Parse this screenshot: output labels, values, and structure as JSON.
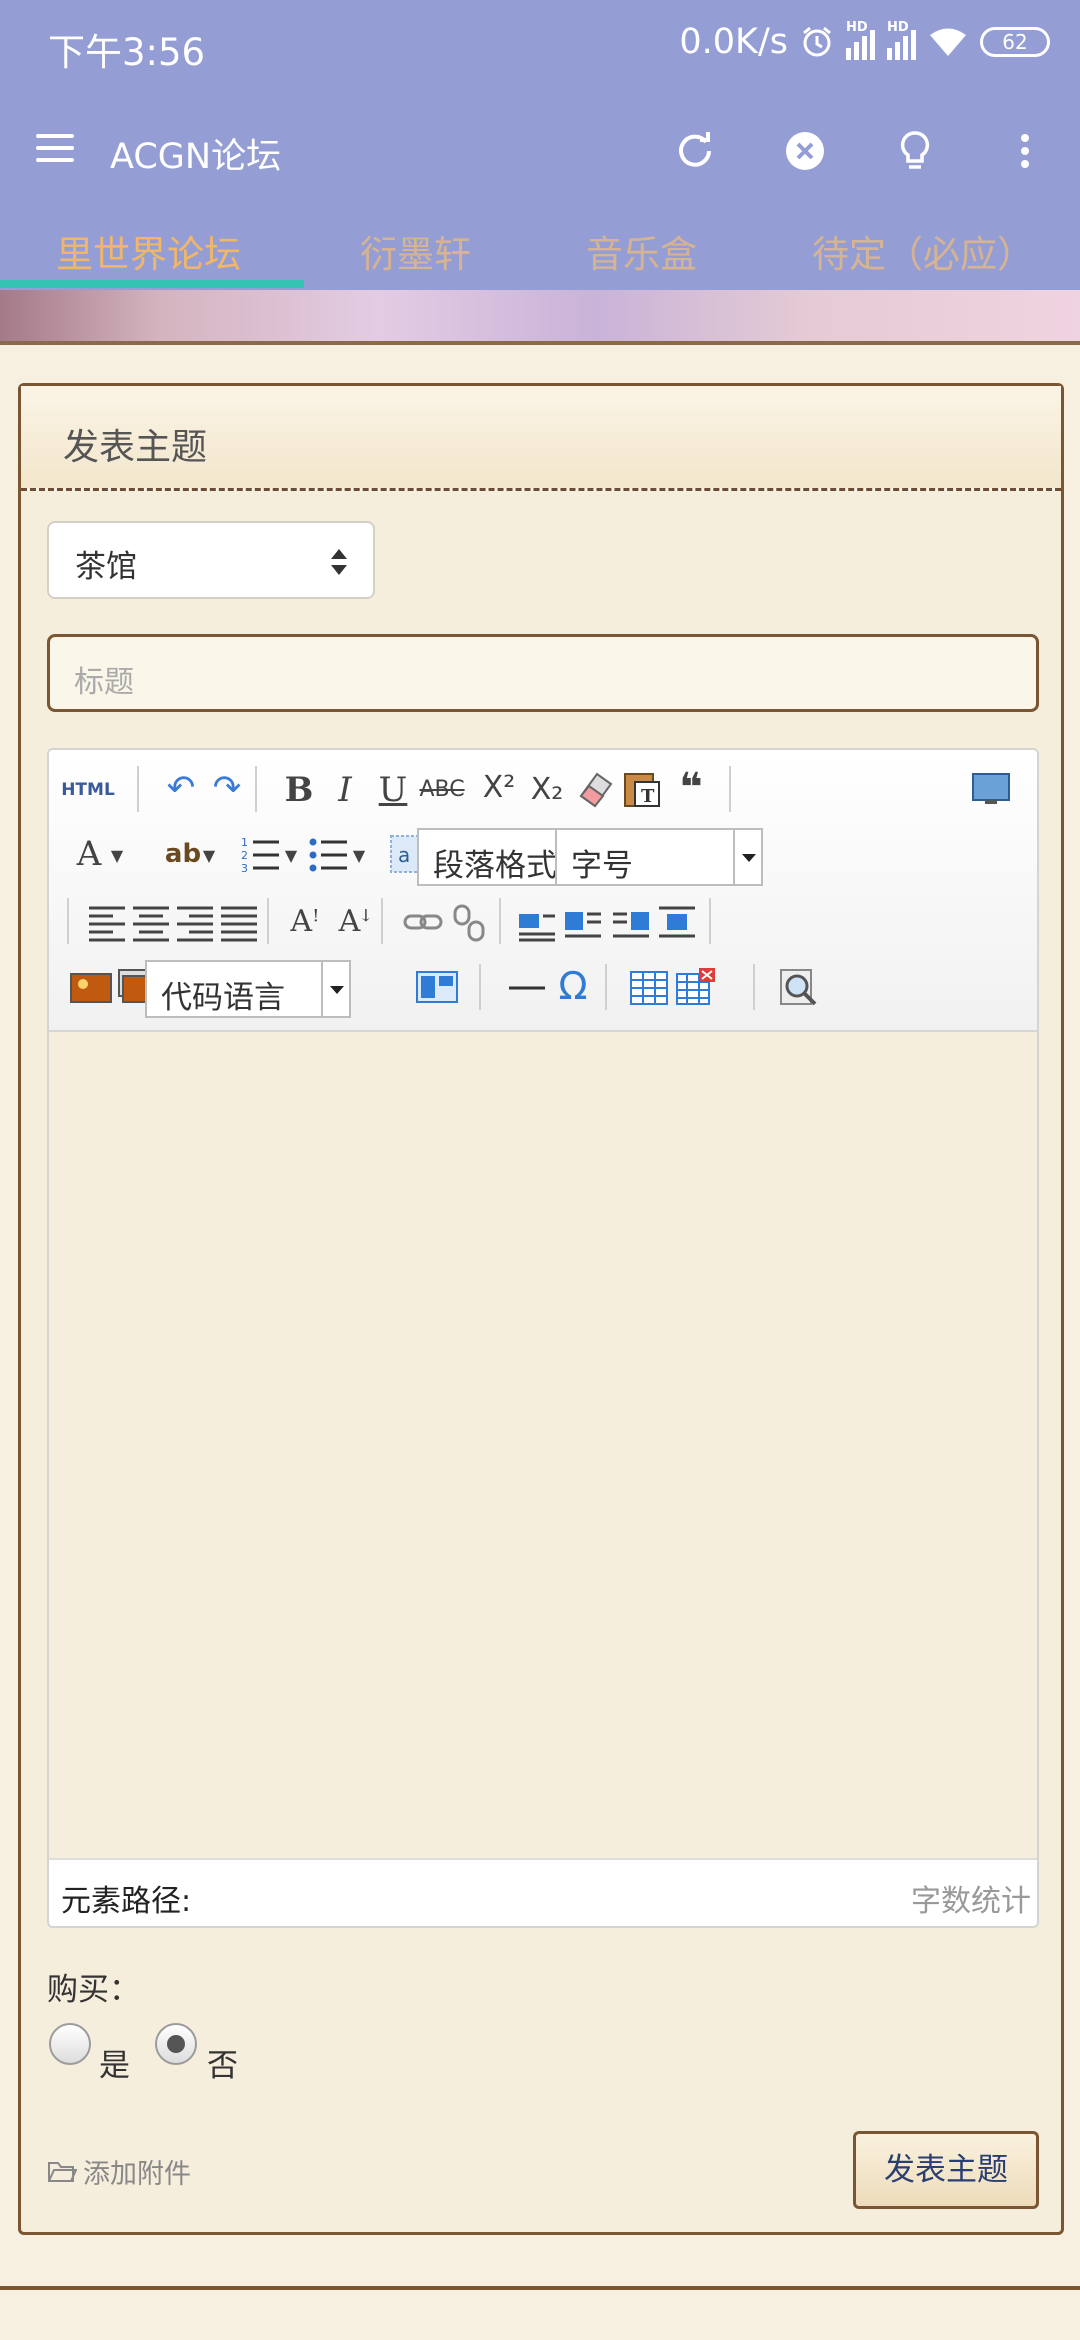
{
  "status_bar": {
    "time": "下午3:56",
    "net_speed": "0.0K/s",
    "hd1": "HD",
    "hd2": "HD",
    "battery": "62"
  },
  "app_bar": {
    "title": "ACGN论坛",
    "icons": [
      "menu-icon",
      "refresh-icon",
      "close-circle-icon",
      "lightbulb-icon",
      "more-vert-icon"
    ]
  },
  "tabs": [
    {
      "label": "里世界论坛",
      "active": true
    },
    {
      "label": "衍墨轩",
      "active": false
    },
    {
      "label": "音乐盒",
      "active": false
    },
    {
      "label": "待定（必应）",
      "active": false
    }
  ],
  "card": {
    "header": "发表主题",
    "forum_select": "茶馆",
    "title_placeholder": "标题"
  },
  "editor": {
    "toolbar": {
      "html_label": "HTML",
      "paragraph_format": "段落格式",
      "font_size": "字号",
      "code_language": "代码语言"
    },
    "element_path_label": "元素路径:",
    "word_count_label": "字数统计"
  },
  "purchase": {
    "label": "购买：",
    "yes": "是",
    "no": "否",
    "selected": "否"
  },
  "attach_label": "添加附件",
  "submit_label": "发表主题",
  "colors": {
    "app_bar": "#959ed4",
    "tab_active": "#f0b66a",
    "tab_inactive": "#d6b493",
    "tab_indicator": "#34c3b3",
    "page_bg": "#f7efdf",
    "border_brown": "#7a5632"
  }
}
